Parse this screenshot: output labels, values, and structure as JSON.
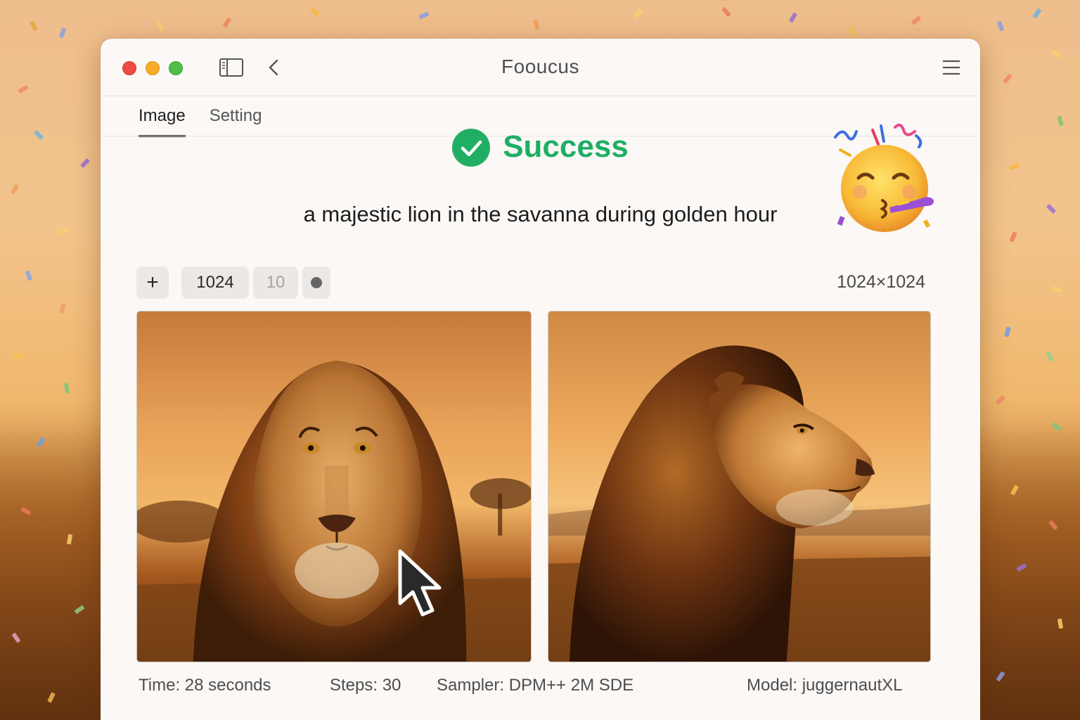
{
  "window": {
    "title": "Fooucus"
  },
  "tabs": [
    {
      "label": "Image",
      "active": true
    },
    {
      "label": "Setting",
      "active": false
    }
  ],
  "status": {
    "label": "Success",
    "color": "#1fae64",
    "icon": "check-circle-icon"
  },
  "prompt": "a majestic lion in the savanna during golden hour",
  "toolbar": {
    "add_label": "+",
    "size_value": "1024",
    "count_value": "10",
    "stop_icon": "record-dot-icon"
  },
  "resolution": "1024×1024",
  "images": [
    {
      "name": "lion-front-portrait",
      "description_icon": "image"
    },
    {
      "name": "lion-side-profile",
      "description_icon": "image"
    }
  ],
  "meta": {
    "time": "Time: 28 seconds",
    "steps": "Steps: 30",
    "sampler": "Sampler: DPM++ 2M SDE",
    "model": "Model: juggernautXL"
  },
  "decorations": {
    "emoji": "party-face-icon",
    "cursor": "mouse-pointer-icon"
  },
  "colors": {
    "accent_success": "#1fae64",
    "close": "#ee4c44",
    "minimize": "#f6ad2a",
    "maximize": "#4fbe4a"
  }
}
